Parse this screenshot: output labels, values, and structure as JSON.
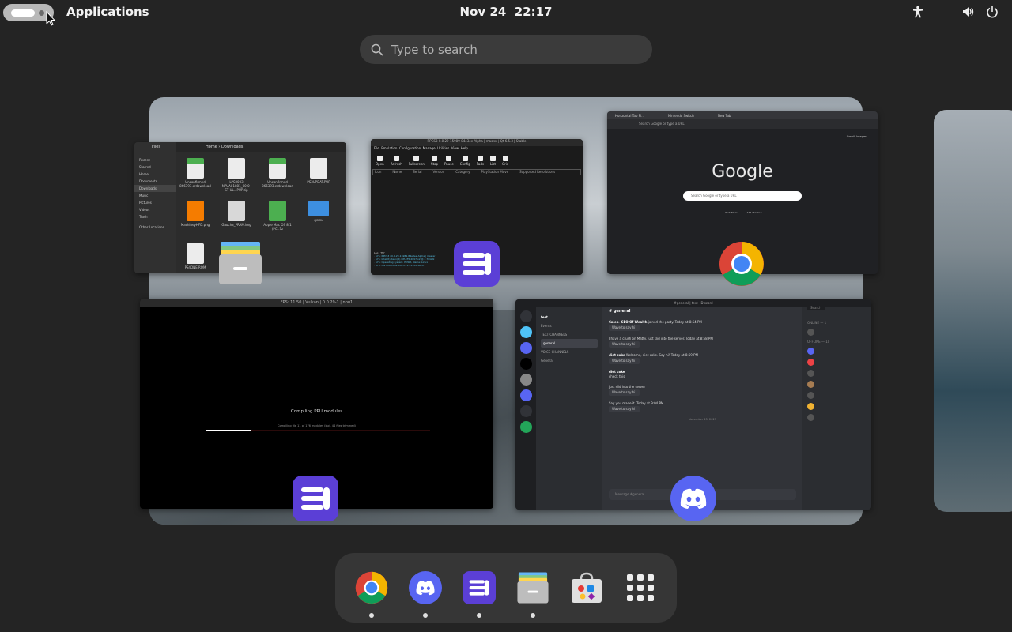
{
  "topbar": {
    "applications_label": "Applications",
    "date": "Nov 24",
    "time": "22:17"
  },
  "search": {
    "placeholder": "Type to search"
  },
  "windows": {
    "files": {
      "title": "Files",
      "location": [
        "Home",
        "Downloads"
      ],
      "sidebar": [
        "Recent",
        "Starred",
        "Home",
        "Documents",
        "Downloads",
        "Music",
        "Pictures",
        "Videos",
        "Trash",
        "Other Locations"
      ],
      "items": [
        "Unconfirmed 866393.crdownload",
        "LPS0003 NPUA81881_00-0-ST UL...PUP.zip",
        "Unconfirmed 866393.crdownload",
        "PS3UPDAT.PUP",
        "MachineyHFD.png",
        "Gaucha_PRAM.img",
        "Apple Mac OS 8.1 (PC).7z",
        "qemu",
        "PS4ONE.ROM"
      ]
    },
    "rpcs3": {
      "title": "RPCS3 0.0.29-15989-84e3ee Alpha | master | Qt 6.5.3 | Stable",
      "menu": [
        "File",
        "Emulation",
        "Configuration",
        "Manage",
        "Utilities",
        "View",
        "Help"
      ],
      "tools": [
        "Open",
        "Refresh",
        "Fullscreen",
        "Stop",
        "Pause",
        "Config",
        "Pads",
        "List",
        "Grid"
      ],
      "columns": [
        "Icon",
        "Name",
        "Serial",
        "Version",
        "Category",
        "PlayStation Move",
        "Supported Resolutions"
      ],
      "log_tabs": [
        "Log",
        "TTY"
      ],
      "log_lines": [
        "· SYS: RPCS3 v0.0.29-15989-84e3ee Alpha | master",
        "· SYS: Intel(R) Xeon(R) CPU E5-2697 v2 @ 2.70GHz",
        "· SYS: Operating system: POSIX, Name: Linux",
        "· SYS: Current Time: 2023-11-24T22:16:57"
      ]
    },
    "chrome": {
      "tabs": [
        "Horizontal Tab Pi...",
        "Nintendo Switch",
        "New Tab"
      ],
      "url_placeholder": "Search Google or type a URL",
      "logo": "Google",
      "search_placeholder": "Search Google or type a URL",
      "shortcuts": [
        "Web Store",
        "Add shortcut"
      ],
      "top_links": [
        "Gmail",
        "Images"
      ]
    },
    "ppu": {
      "title": "FPS: 11.50 | Vulkan | 0.0.29-1 | npu1",
      "message": "Compiling PPU modules",
      "sub": "Compiling file 11 of 176 modules (incl. 44 files trimmed)",
      "progress": 0.2
    },
    "discord": {
      "title": "#general | test - Discord",
      "server": "test",
      "events": "Events",
      "text_channels_label": "TEXT CHANNELS",
      "text_channel": "general",
      "voice_channels_label": "VOICE CHANNELS",
      "voice_channel": "General",
      "channel_header": "general",
      "messages": [
        {
          "author": "Caleb- CEO Of Wealth",
          "text": "joined the party. Today at 8:54 PM",
          "wave": "Wave to say hi!"
        },
        {
          "author": "",
          "text": "I have a crush on Matty. Just slid into the server. Today at 8:58 PM",
          "wave": "Wave to say hi!"
        },
        {
          "author": "diet coke",
          "text": "Welcome, diet coke. Say hi! Today at 8:59 PM",
          "wave": "Wave to say hi!"
        },
        {
          "author": "diet coke",
          "text": "check this",
          "wave": ""
        },
        {
          "author": "",
          "text": "just slid into the server",
          "wave": "Wave to say hi!"
        },
        {
          "author": "",
          "text": "Say you made it. Today at 9:04 PM",
          "wave": "Wave to say hi!"
        }
      ],
      "date_divider": "November 25, 2023",
      "input_placeholder": "Message #general",
      "members_online": "ONLINE — 1",
      "members_offline": "OFFLINE — 10",
      "search_placeholder": "Search"
    }
  },
  "dash": {
    "apps": [
      {
        "name": "Google Chrome",
        "running": true
      },
      {
        "name": "Discord",
        "running": true
      },
      {
        "name": "RPCS3",
        "running": true
      },
      {
        "name": "Files",
        "running": true
      },
      {
        "name": "Software",
        "running": false
      },
      {
        "name": "Show Apps",
        "running": false
      }
    ]
  },
  "colors": {
    "accent": "#5865f2",
    "rpcs3_purple": "#5b3fd6",
    "panel": "#242424"
  }
}
